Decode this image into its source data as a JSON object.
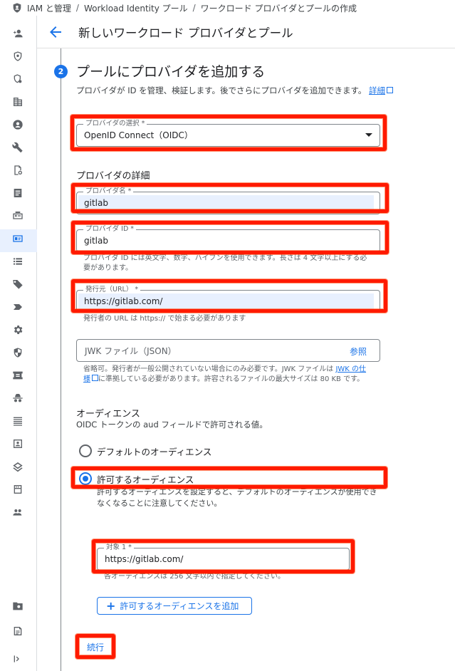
{
  "breadcrumb": {
    "items": [
      "IAM と管理",
      "Workload Identity プール",
      "ワークロード プロバイダとプールの作成"
    ]
  },
  "header": {
    "title": "新しいワークロード プロバイダとプール"
  },
  "step": {
    "number": "2",
    "title": "プールにプロバイダを追加する",
    "description": "プロバイダが ID を管理、検証します。後でさらにプロバイダを追加できます。",
    "details_link": "詳細"
  },
  "provider_select": {
    "label": "プロバイダの選択 *",
    "value": "OpenID Connect（OIDC）"
  },
  "provider_details": {
    "heading": "プロバイダの詳細",
    "name": {
      "label": "プロバイダ名 *",
      "value": "gitlab"
    },
    "id": {
      "label": "プロバイダ ID *",
      "value": "gitlab",
      "hint": "プロバイダ ID には英文字、数字、ハイフンを使用できます。長さは 4 文字以上にする必要があります。"
    },
    "issuer": {
      "label": "発行元（URL） *",
      "value": "https://gitlab.com/",
      "hint": "発行者の URL は https:// で始まる必要があります"
    },
    "jwk": {
      "placeholder": "JWK ファイル（JSON）",
      "browse": "参照",
      "hint_before": "省略可。発行者が一般公開されていない場合にのみ必要です。JWK ファイルは",
      "hint_link": "JWK の仕様",
      "hint_after": "に準拠している必要があります。許容されるファイルの最大サイズは 80 KB です。"
    }
  },
  "audience": {
    "heading": "オーディエンス",
    "subtitle": "OIDC トークンの aud フィールドで許可される値。",
    "default_option": "デフォルトのオーディエンス",
    "allowed_option": "許可するオーディエンス",
    "allowed_hint": "許可するオーディエンスを設定すると、デフォルトのオーディエンスが使用できなくなることに注意してください。",
    "target": {
      "label": "対象 1 *",
      "value": "https://gitlab.com/",
      "hint": "各オーディエンスは 256 文字以内で指定してください。"
    },
    "add_button": "許可するオーディエンスを追加"
  },
  "continue_button": "続行",
  "nav_icons": [
    "add-person-icon",
    "shield-icon",
    "policy-icon",
    "building-icon",
    "account-icon",
    "wrench-icon",
    "document-search-icon",
    "article-icon",
    "badge-icon",
    "workload-identity-icon",
    "list-icon",
    "tag-icon",
    "label-icon",
    "gear-icon",
    "security-icon",
    "receipt-icon",
    "incognito-icon",
    "lines-icon",
    "contacts-icon",
    "layers-icon",
    "storage-icon",
    "groups-icon",
    "folder-gear-icon",
    "notes-icon",
    "expand-rail-icon"
  ],
  "colors": {
    "accent": "#1a73e8",
    "highlight": "#ff1a00"
  }
}
